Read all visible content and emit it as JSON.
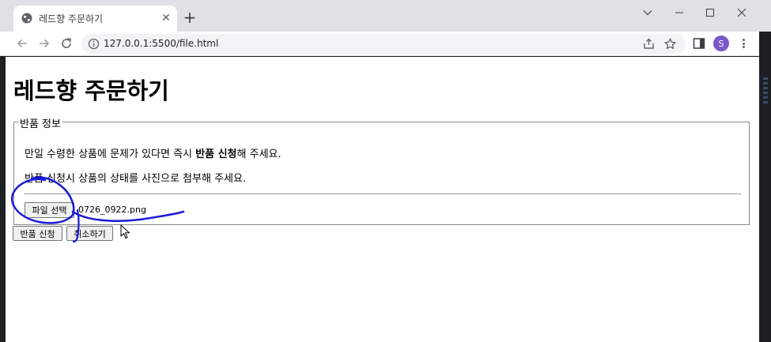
{
  "browser": {
    "tab_title": "레드향 주문하기",
    "tab_close": "✕",
    "new_tab": "+",
    "url": "127.0.0.1:5500/file.html",
    "avatar_letter": "S"
  },
  "page": {
    "title": "레드향 주문하기",
    "fieldset_legend": "반품 정보",
    "p1_before": "만일 수령한 상품에 문제가 있다면 즉시 ",
    "p1_bold": "반품 신청",
    "p1_after": "해 주세요.",
    "p2": "반품 신청시 상품의 상태를 사진으로 첨부해 주세요.",
    "file_button": "파일 선택",
    "file_name": "0726_0922.png",
    "submit_button": "반품 신청",
    "cancel_button": "취소하기"
  },
  "colors": {
    "annotation": "#1a1ad6",
    "avatar": "#7b57c7"
  }
}
